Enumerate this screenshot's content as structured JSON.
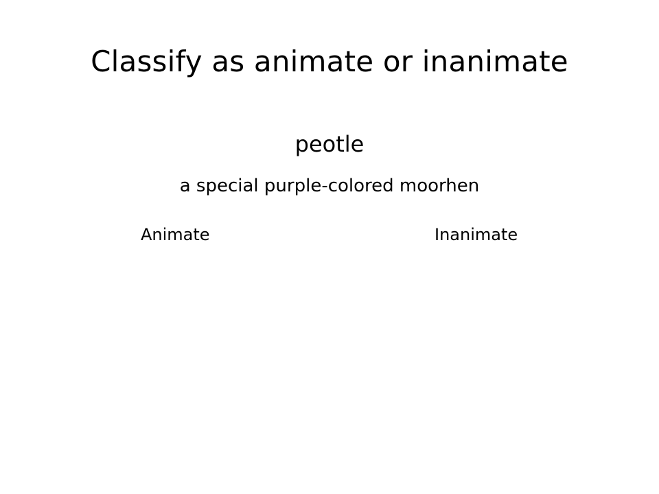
{
  "slide": {
    "title": "Classify as animate or inanimate",
    "word": "peotle",
    "definition": "a special purple-colored moorhen",
    "options": [
      {
        "label": "Animate"
      },
      {
        "label": "Inanimate"
      }
    ]
  }
}
